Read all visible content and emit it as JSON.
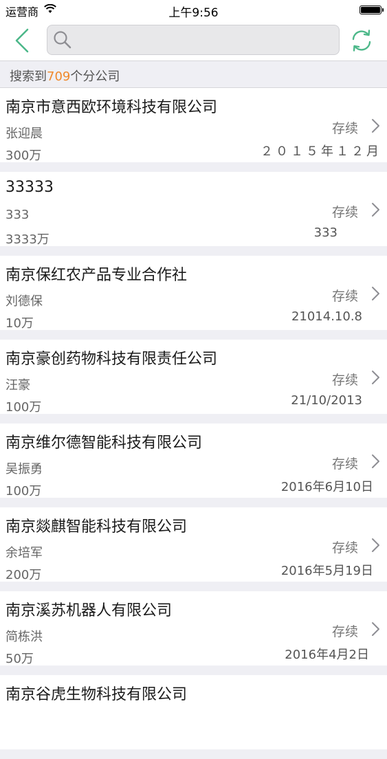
{
  "status_bar": {
    "carrier": "运营商",
    "time": "上午9:56"
  },
  "nav": {
    "search_value": "",
    "search_placeholder": ""
  },
  "results": {
    "prefix": "搜索到",
    "count": "709",
    "suffix": "个分公司"
  },
  "companies": [
    {
      "name": "南京市意西欧环境科技有限公司",
      "person": "张迎晨",
      "capital": "300万",
      "status": "存续",
      "date": "２０１５年１２月"
    },
    {
      "name": "33333",
      "person": "333",
      "capital": "3333万",
      "status": "存续",
      "date": "333"
    },
    {
      "name": "南京保红农产品专业合作社",
      "person": "刘德保",
      "capital": "10万",
      "status": "存续",
      "date": "21014.10.8"
    },
    {
      "name": "南京豪创药物科技有限责任公司",
      "person": "汪豪",
      "capital": "100万",
      "status": "存续",
      "date": "21/10/2013"
    },
    {
      "name": "南京维尔德智能科技有限公司",
      "person": "吴振勇",
      "capital": "100万",
      "status": "存续",
      "date": "2016年6月10日"
    },
    {
      "name": "南京燚麒智能科技有限公司",
      "person": "余培军",
      "capital": "200万",
      "status": "存续",
      "date": "2016年5月19日"
    },
    {
      "name": "南京溪苏机器人有限公司",
      "person": "简栋洪",
      "capital": "50万",
      "status": "存续",
      "date": "2016年4月2日"
    },
    {
      "name": "南京谷虎生物科技有限公司",
      "person": "",
      "capital": "",
      "status": "",
      "date": ""
    }
  ],
  "colors": {
    "accent_green": "#4db88a",
    "count_orange": "#f0892b",
    "background": "#efeff4"
  },
  "icons": {
    "back": "chevron-left-icon",
    "search": "search-icon",
    "refresh": "refresh-icon",
    "row_arrow": "chevron-right-icon",
    "wifi": "wifi-icon",
    "battery": "battery-icon"
  }
}
